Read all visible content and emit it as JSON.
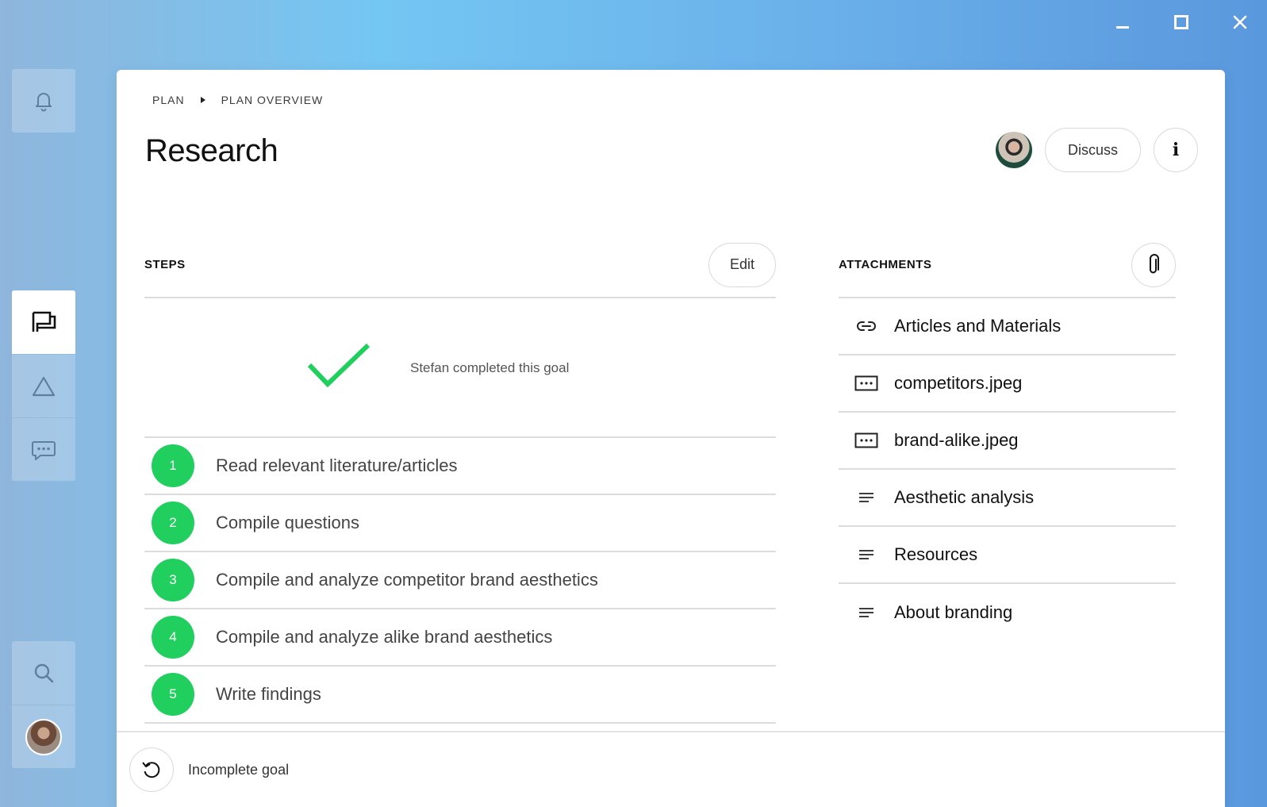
{
  "window": {
    "controls": [
      "minimize-icon",
      "maximize-icon",
      "close-icon"
    ]
  },
  "rail": {
    "top": [
      {
        "icon": "bell-icon"
      }
    ],
    "middle": [
      {
        "icon": "flag-icon",
        "active": true
      },
      {
        "icon": "triangle-icon"
      },
      {
        "icon": "chat-bubble-icon"
      }
    ],
    "bottom": [
      {
        "icon": "search-icon"
      },
      {
        "icon": "avatar"
      }
    ]
  },
  "breadcrumb": {
    "root": "PLAN",
    "current": "PLAN OVERVIEW"
  },
  "page": {
    "title": "Research"
  },
  "header": {
    "discuss_label": "Discuss",
    "info_label": "i"
  },
  "steps": {
    "label": "STEPS",
    "edit_label": "Edit",
    "completed_message": "Stefan completed this goal",
    "items": [
      {
        "num": "1",
        "text": "Read relevant literature/articles"
      },
      {
        "num": "2",
        "text": "Compile questions"
      },
      {
        "num": "3",
        "text": "Compile and analyze competitor brand aesthetics"
      },
      {
        "num": "4",
        "text": "Compile and analyze alike brand aesthetics"
      },
      {
        "num": "5",
        "text": "Write findings"
      }
    ]
  },
  "attachments": {
    "label": "ATTACHMENTS",
    "items": [
      {
        "icon": "link-icon",
        "text": "Articles and Materials"
      },
      {
        "icon": "image-file-icon",
        "text": "competitors.jpeg"
      },
      {
        "icon": "image-file-icon",
        "text": "brand-alike.jpeg"
      },
      {
        "icon": "document-lines-icon",
        "text": "Aesthetic analysis"
      },
      {
        "icon": "document-lines-icon",
        "text": "Resources"
      },
      {
        "icon": "document-lines-icon",
        "text": "About branding"
      }
    ]
  },
  "footer": {
    "incomplete_label": "Incomplete goal"
  },
  "colors": {
    "accent_green": "#21cf5f",
    "divider": "#dcdcdc"
  }
}
